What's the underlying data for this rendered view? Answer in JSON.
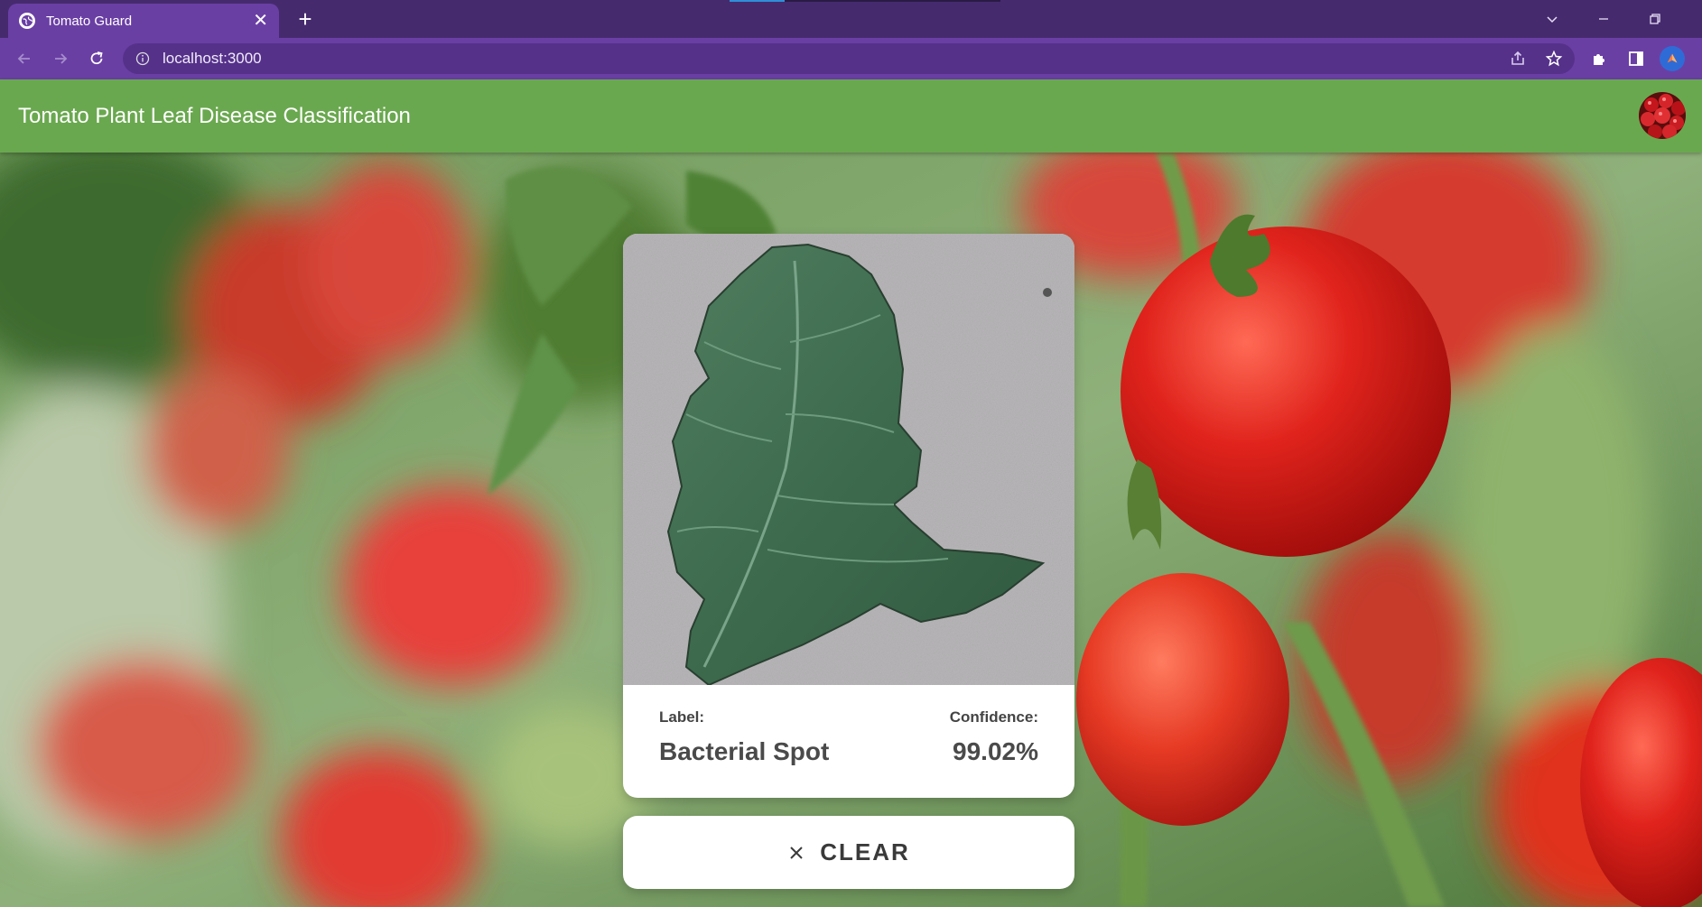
{
  "browser": {
    "tab": {
      "title": "Tomato Guard"
    },
    "address": {
      "url": "localhost:3000"
    }
  },
  "app": {
    "title": "Tomato Plant Leaf Disease Classification"
  },
  "result": {
    "label_key": "Label:",
    "label_value": "Bacterial Spot",
    "confidence_key": "Confidence:",
    "confidence_value": "99.02%"
  },
  "actions": {
    "clear_label": "CLEAR"
  },
  "colors": {
    "appbar": "#6aa84f",
    "browser_frame": "#462a6e",
    "browser_toolbar": "#6a3fa4"
  }
}
